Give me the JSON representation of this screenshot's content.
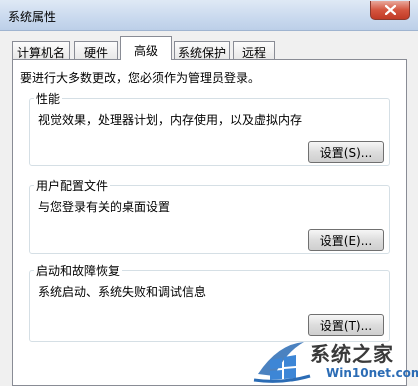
{
  "window": {
    "title": "系统属性"
  },
  "tabs": [
    {
      "label": "计算机名"
    },
    {
      "label": "硬件"
    },
    {
      "label": "高级"
    },
    {
      "label": "系统保护"
    },
    {
      "label": "远程"
    }
  ],
  "active_tab": "高级",
  "notice": "要进行大多数更改，您必须作为管理员登录。",
  "groups": {
    "performance": {
      "title": "性能",
      "description": "视觉效果，处理器计划，内存使用，以及虚拟内存",
      "button": "设置(S)..."
    },
    "user_profiles": {
      "title": "用户配置文件",
      "description": "与您登录有关的桌面设置",
      "button": "设置(E)..."
    },
    "startup_recovery": {
      "title": "启动和故障恢复",
      "description": "系统启动、系统失败和调试信息",
      "button": "设置(T)..."
    }
  },
  "watermark": {
    "brand": "系统之家",
    "url": "Win10net.com"
  },
  "colors": {
    "close_button": "#c13b26",
    "titlebar": "#c9d9ee",
    "watermark_blue": "#2b6cb5"
  }
}
